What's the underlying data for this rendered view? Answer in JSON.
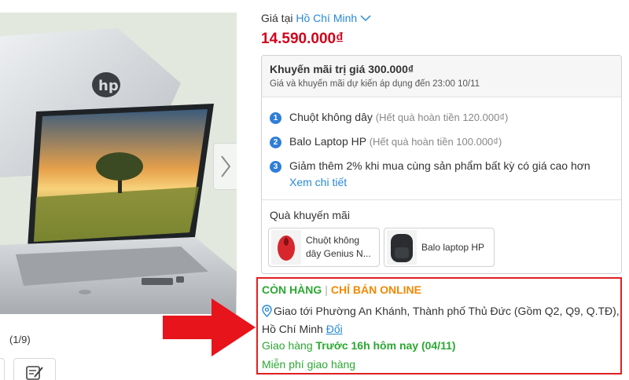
{
  "gallery": {
    "counter": "(1/9)",
    "next_icon": "chevron-right-icon",
    "thumb_icon": "edit-note-icon"
  },
  "price_section": {
    "label": "Giá tại",
    "city": "Hồ Chí Minh",
    "price": "14.590.000₫"
  },
  "promo": {
    "title": "Khuyến mãi trị giá 300.000₫",
    "note": "Giá và khuyến mãi dự kiến áp dụng đến 23:00 10/11",
    "offers": [
      {
        "num": "1",
        "text": "Chuột không dây",
        "sub": "(Hết quà hoàn tiền 120.000₫)"
      },
      {
        "num": "2",
        "text": "Balo Laptop HP",
        "sub": "(Hết quà hoàn tiền 100.000₫)"
      },
      {
        "num": "3",
        "text": "Giảm thêm 2% khi mua cùng sản phẩm bất kỳ có giá cao hơn",
        "sub": ""
      }
    ],
    "see_more": "Xem chi tiết",
    "gifts_title": "Quà khuyến mãi",
    "gifts": [
      {
        "label_line1": "Chuột không",
        "label_line2": "dây Genius N..."
      },
      {
        "label_line1": "Balo laptop HP",
        "label_line2": ""
      }
    ]
  },
  "stock": {
    "status": "CÒN HÀNG",
    "separator": "|",
    "channel": "CHỈ BÁN ONLINE",
    "address_line": "Giao tới Phường An Khánh, Thành phố Thủ Đức (Gồm Q2, Q9, Q.TĐ),",
    "address_city": "Hồ Chí Minh",
    "change_link": "Đổi",
    "delivery_prefix": "Giao hàng",
    "delivery_time": "Trước 16h hôm nay (04/11)",
    "free_shipping": "Miễn phí giao hàng"
  },
  "colors": {
    "price": "#d0021b",
    "link": "#288ad6",
    "in_stock": "#2ba832",
    "online": "#f28902",
    "highlight": "#e02020"
  }
}
